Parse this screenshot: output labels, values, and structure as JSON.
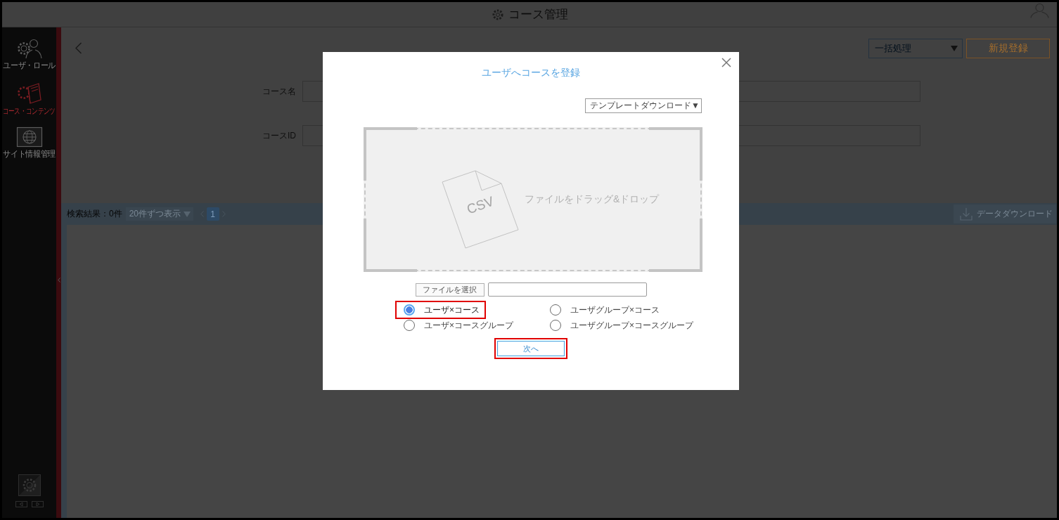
{
  "header": {
    "title": "コース管理"
  },
  "sidebar": {
    "items": [
      {
        "kind": "users",
        "label": "ユーザ・ロール",
        "selected": false
      },
      {
        "kind": "courses",
        "label": "コース・コンテンツ",
        "selected": true
      },
      {
        "kind": "site",
        "label": "サイト情報管理",
        "selected": false
      }
    ]
  },
  "toolbar": {
    "bulk_select": "一括処理",
    "new_button": "新規登録"
  },
  "search_form": {
    "fields": [
      {
        "label": "コース名"
      },
      {
        "label": "コースID"
      }
    ]
  },
  "results": {
    "count": "検索結果：0件",
    "page_size": "20件ずつ表示",
    "pages": [
      {
        "label": "1",
        "selected": true
      }
    ],
    "download_button": "データダウンロード"
  },
  "dialog": {
    "title": "ユーザへコースを登録",
    "template_select": "テンプレートダウンロード▼",
    "drop_zone": {
      "file_type": "CSV",
      "text": "ファイルをドラッグ&ドロップ"
    },
    "file_button": "ファイルを選択",
    "options": [
      {
        "label": "ユーザ×コース",
        "selected": true,
        "highlighted": true
      },
      {
        "label": "ユーザグループ×コース",
        "selected": false,
        "highlighted": false
      },
      {
        "label": "ユーザ×コースグループ",
        "selected": false,
        "highlighted": false
      },
      {
        "label": "ユーザグループ×コースグループ",
        "selected": false,
        "highlighted": false
      }
    ],
    "next_button": {
      "label": "次へ",
      "highlighted": true
    }
  }
}
